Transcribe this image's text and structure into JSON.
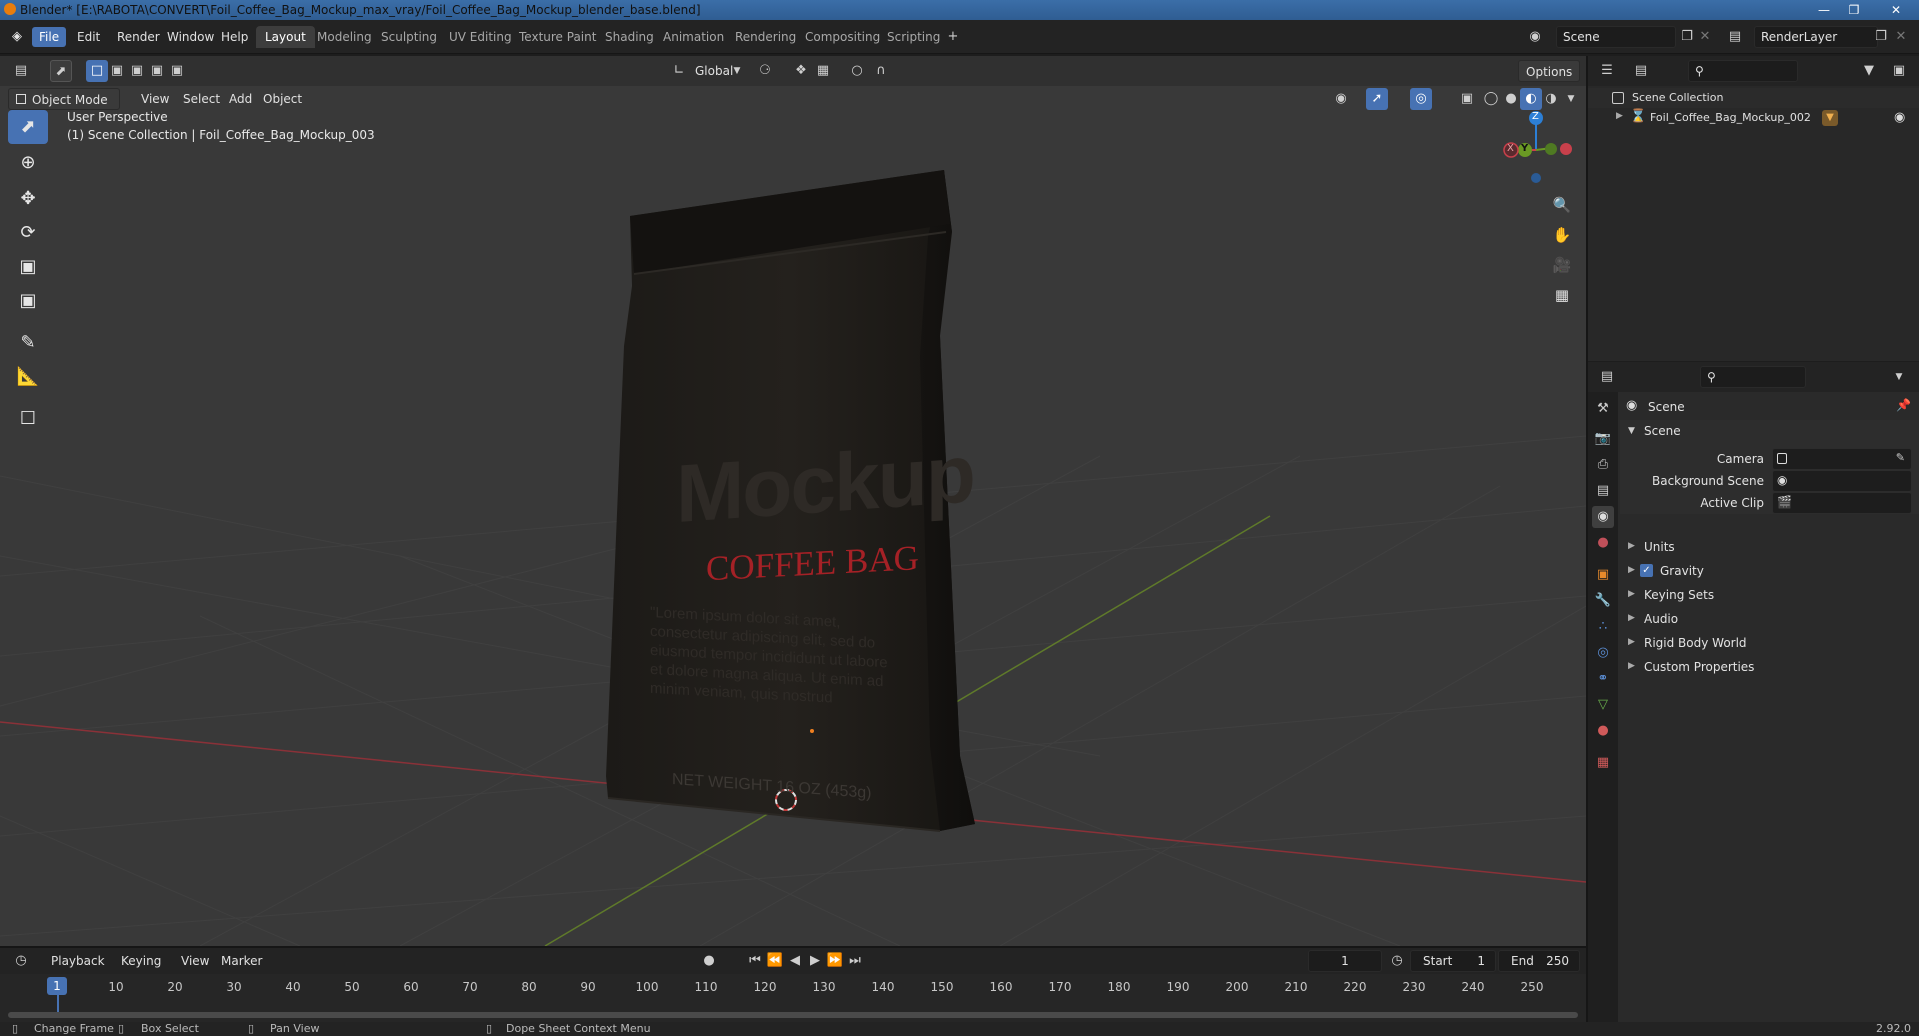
{
  "window": {
    "title": "Blender* [E:\\RABOTA\\CONVERT\\Foil_Coffee_Bag_Mockup_max_vray/Foil_Coffee_Bag_Mockup_blender_base.blend]"
  },
  "menu": [
    "File",
    "Edit",
    "Render",
    "Window",
    "Help"
  ],
  "workspaces": [
    "Layout",
    "Modeling",
    "Sculpting",
    "UV Editing",
    "Texture Paint",
    "Shading",
    "Animation",
    "Rendering",
    "Compositing",
    "Scripting"
  ],
  "scene_field": "Scene",
  "render_layer_field": "RenderLayer",
  "viewport": {
    "transform_orientation": "Global",
    "options_label": "Options",
    "mode": "Object Mode",
    "menus": [
      "View",
      "Select",
      "Add",
      "Object"
    ],
    "perspective": "User Perspective",
    "collection_info": "(1) Scene Collection | Foil_Coffee_Bag_Mockup_003",
    "gizmo_axes": {
      "z": "Z",
      "y": "Y",
      "x": "X"
    }
  },
  "bag": {
    "brand": "Mockup",
    "product": "COFFEE BAG",
    "copy_lines": [
      "\"Lorem ipsum dolor sit amet,",
      "consectetur adipiscing elit, sed do",
      "eiusmod tempor incididunt ut labore",
      "et dolore magna aliqua. Ut enim ad",
      "minim veniam, quis nostrud"
    ],
    "net_weight": "NET WEIGHT 16 OZ (453g)"
  },
  "outliner": {
    "root": "Scene Collection",
    "items": [
      "Foil_Coffee_Bag_Mockup_002"
    ]
  },
  "properties": {
    "context": "Scene",
    "panel": "Scene",
    "fields": [
      {
        "label": "Camera"
      },
      {
        "label": "Background Scene"
      },
      {
        "label": "Active Clip"
      }
    ],
    "subpanels": [
      "Units",
      "Gravity",
      "Keying Sets",
      "Audio",
      "Rigid Body World",
      "Custom Properties"
    ],
    "gravity_checked": true
  },
  "timeline": {
    "menus": [
      "Playback",
      "Keying",
      "View",
      "Marker"
    ],
    "current_frame": "1",
    "start_label": "Start",
    "start_value": "1",
    "end_label": "End",
    "end_value": "250",
    "ticks": [
      "1",
      "10",
      "20",
      "30",
      "40",
      "50",
      "60",
      "70",
      "80",
      "90",
      "100",
      "110",
      "120",
      "130",
      "140",
      "150",
      "160",
      "170",
      "180",
      "190",
      "200",
      "210",
      "220",
      "230",
      "240",
      "250"
    ]
  },
  "statusbar": {
    "hints": [
      "Change Frame",
      "Box Select",
      "Pan View",
      "Dope Sheet Context Menu"
    ],
    "version": "2.92.0"
  },
  "colors": {
    "accent": "#4772b3",
    "x_axis": "#c8404b",
    "y_axis": "#6a9a24",
    "z_axis": "#2c7fd6",
    "product_text": "#a52126"
  }
}
